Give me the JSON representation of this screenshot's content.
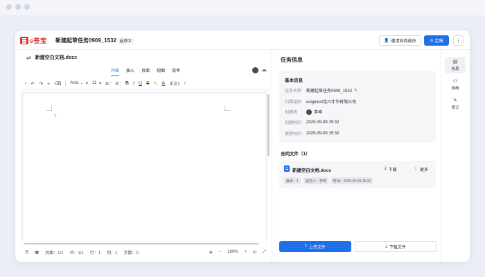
{
  "header": {
    "logo_text": "e签宝",
    "task_title": "新建起草任务0909_1532",
    "status": "起草中",
    "invite_label": "邀请协商成员",
    "sign_label": "定稿",
    "more_label": "⋮"
  },
  "editor": {
    "doc_title": "新建空白文档.docx",
    "tabs": [
      {
        "label": "开始",
        "active": true
      },
      {
        "label": "插入"
      },
      {
        "label": "页面"
      },
      {
        "label": "视图"
      },
      {
        "label": "效率"
      }
    ],
    "toolbar": {
      "font_name": "Arial ...",
      "font_size": "11",
      "style_label": "正文1"
    },
    "statusbar": {
      "page": "页面：1/1",
      "section": "节：1/1",
      "row": "行：1",
      "col": "列：1",
      "words": "字数：0",
      "zoom": "100%"
    }
  },
  "info_panel": {
    "title": "任务信息",
    "basic_title": "基本信息",
    "rows": [
      {
        "label": "任务名称",
        "value": "新建起草任务0909_1532"
      },
      {
        "label": "归属组织",
        "value": "esigntest北川才华有限公司"
      },
      {
        "label": "创建者",
        "value": "李坤"
      },
      {
        "label": "创建时间",
        "value": "2025-09-09 15:32"
      },
      {
        "label": "更新时间",
        "value": "2025-09-09 15:32"
      }
    ],
    "files_title": "合同文件（1）",
    "file": {
      "name": "新建空白文档.docx",
      "download": "下载",
      "more": "更多",
      "meta": [
        "版本：1",
        "提交人：李坤",
        "时间：2025-09-09 15:32"
      ]
    },
    "upload_label": "上传文件",
    "download_label": "下载文件"
  },
  "rail": {
    "items": [
      {
        "label": "信息",
        "icon": "info-icon",
        "active": true
      },
      {
        "label": "协商",
        "icon": "users-icon"
      },
      {
        "label": "修订",
        "icon": "pen-icon"
      }
    ]
  },
  "colors": {
    "accent": "#1f6fe8",
    "brand": "#e0312b"
  }
}
